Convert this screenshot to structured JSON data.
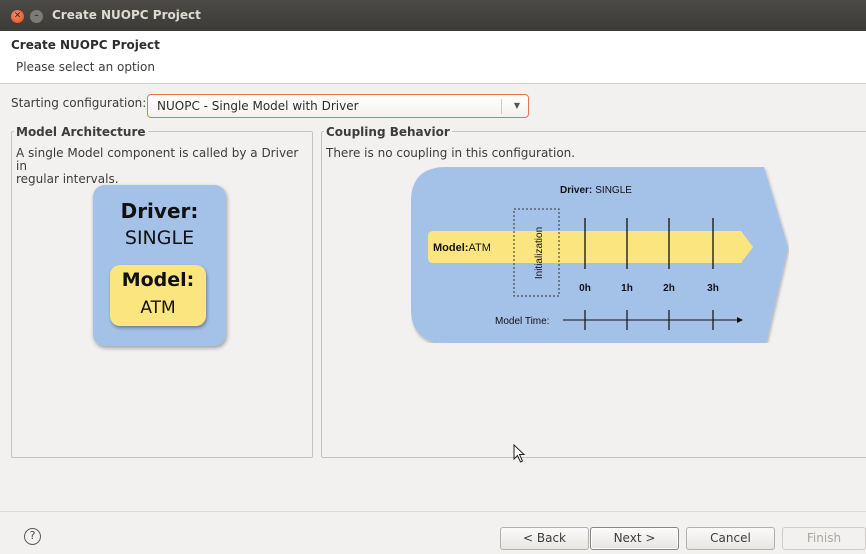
{
  "window": {
    "title": "Create NUOPC Project"
  },
  "header": {
    "title": "Create NUOPC Project",
    "message": "Please select an option"
  },
  "config": {
    "label": "Starting configuration:",
    "selected": "NUOPC - Single Model with Driver"
  },
  "architecture": {
    "group_title": "Model Architecture",
    "description_line1": "A single Model component is called by a Driver in",
    "description_line2": "regular intervals.",
    "driver_label": "Driver:",
    "driver_name": "SINGLE",
    "model_label": "Model:",
    "model_name": "ATM"
  },
  "coupling": {
    "group_title": "Coupling Behavior",
    "description": "There is no coupling in this configuration.",
    "driver_label": "Driver:",
    "driver_name": "SINGLE",
    "model_label": "Model:",
    "model_name": "ATM",
    "init_label": "Initialization",
    "time_labels": [
      "0h",
      "1h",
      "2h",
      "3h"
    ],
    "model_time_label": "Model Time:"
  },
  "buttons": {
    "help": "?",
    "back": "< Back",
    "next": "Next >",
    "cancel": "Cancel",
    "finish": "Finish"
  },
  "colors": {
    "driver_blue": "#a4c1e8",
    "model_yellow": "#fbe57e",
    "accent_orange": "#e8754b"
  }
}
